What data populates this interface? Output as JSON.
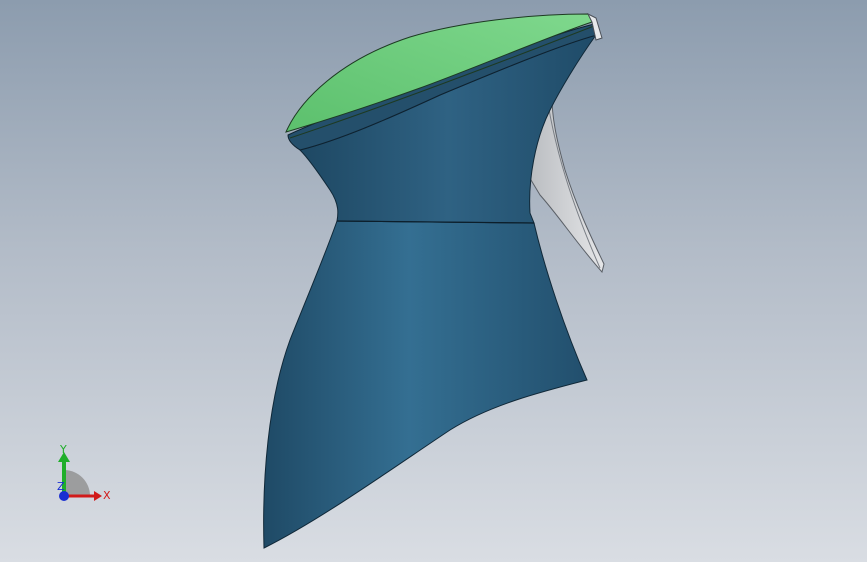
{
  "viewport": {
    "background_top": "#8c9cae",
    "background_bottom": "#d9dde3"
  },
  "model": {
    "body_color": "#2f6283",
    "cap_color": "#6fcf7f",
    "trigger_color": "#d4d6d9"
  },
  "triad": {
    "x_label": "X",
    "y_label": "Y",
    "z_label": "Z",
    "x_color": "#d11a1a",
    "y_color": "#1fae2a",
    "z_color": "#1a2fd1"
  }
}
